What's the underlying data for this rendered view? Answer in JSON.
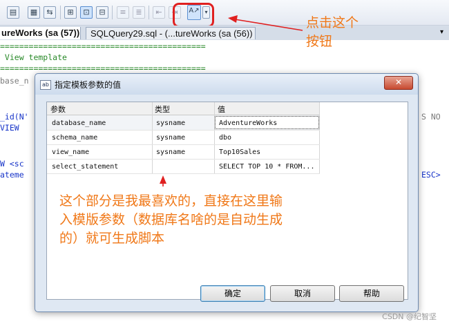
{
  "toolbar": {
    "icons": [
      "results-to-grid-icon",
      "results-to-text-icon",
      "results-to-file-icon",
      "display-plan-icon",
      "include-plan-icon",
      "client-stats-icon",
      "comment-icon",
      "uncomment-icon",
      "decrease-indent-icon",
      "increase-indent-icon",
      "specify-template-parameters-icon"
    ],
    "template_button_glyph": "A↗"
  },
  "tabs": [
    {
      "label": "ureWorks (sa (57))"
    },
    {
      "label": "SQLQuery29.sql - (...tureWorks (sa (56))"
    }
  ],
  "tab_menu_glyph": "▾",
  "editor": {
    "lines": [
      {
        "text": "===========================================",
        "color": "green"
      },
      {
        "text": " View template",
        "color": "green"
      },
      {
        "text": "===========================================",
        "color": "green"
      },
      {
        "text": "base_n",
        "color": "grey"
      },
      {
        "text": "_id(N'",
        "color": "blue"
      },
      {
        "text": "VIEW ",
        "color": "blue"
      },
      {
        "text": "W <sc",
        "color": "blue"
      },
      {
        "text": "ateme",
        "color": "blue"
      }
    ],
    "right_fragments": [
      "S NO",
      "ESC>"
    ]
  },
  "annotations": {
    "top": [
      "点击这个",
      "按钮"
    ],
    "middle": [
      "这个部分是我最喜欢的，直接在这里输",
      "入模版参数（数据库名啥的是自动生成",
      "的）就可生成脚本"
    ]
  },
  "dialog": {
    "title": "指定模板参数的值",
    "icon_text": "ab",
    "close_glyph": "✕",
    "columns": [
      "参数",
      "类型",
      "值"
    ],
    "rows": [
      {
        "param": "database_name",
        "type": "sysname",
        "value": "AdventureWorks"
      },
      {
        "param": "schema_name",
        "type": "sysname",
        "value": "dbo"
      },
      {
        "param": "view_name",
        "type": "sysname",
        "value": "Top10Sales"
      },
      {
        "param": "select_statement",
        "type": "",
        "value": "SELECT TOP 10 * FROM..."
      }
    ],
    "buttons": {
      "ok": "确定",
      "cancel": "取消",
      "help": "帮助"
    }
  },
  "watermark": "CSDN @纪智坚",
  "colors": {
    "annotation": "#f07818",
    "highlight": "#e02020",
    "arrow": "#e02020"
  }
}
